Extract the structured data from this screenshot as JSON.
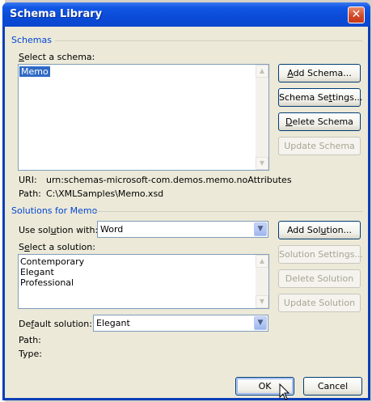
{
  "window": {
    "title": "Schema Library",
    "close_glyph": "✕"
  },
  "schemas": {
    "group_label": "Schemas",
    "select_label_accel": "S",
    "select_label_rest": "elect a schema:",
    "items": [
      "Memo"
    ],
    "selected_index": 0,
    "uri_label": "URI:",
    "uri_value": "urn:schemas-microsoft-com.demos.memo.noAttributes",
    "path_label": "Path:",
    "path_value": "C:\\XMLSamples\\Memo.xsd",
    "buttons": {
      "add_accel": "A",
      "add_rest": "dd Schema...",
      "settings_pre": "Schema Se",
      "settings_accel": "t",
      "settings_post": "tings...",
      "delete_accel": "D",
      "delete_rest": "elete Schema",
      "update": "Update Schema"
    }
  },
  "solutions": {
    "group_label": "Solutions for Memo",
    "use_with_pre": "Use sol",
    "use_with_accel": "u",
    "use_with_post": "tion with:",
    "use_with_value": "Word",
    "add_pre": "Add Sol",
    "add_accel": "u",
    "add_post": "tion...",
    "settings": "Solution Settings...",
    "delete": "Delete Solution",
    "update": "Update Solution",
    "select_pre": "S",
    "select_accel": "e",
    "select_post": "lect a solution:",
    "items": [
      "Contemporary",
      "Elegant",
      "Professional"
    ],
    "default_pre": "De",
    "default_accel": "f",
    "default_post": "ault solution:",
    "default_value": "Elegant",
    "path_label": "Path:",
    "type_label": "Type:"
  },
  "footer": {
    "ok": "OK",
    "cancel": "Cancel"
  }
}
